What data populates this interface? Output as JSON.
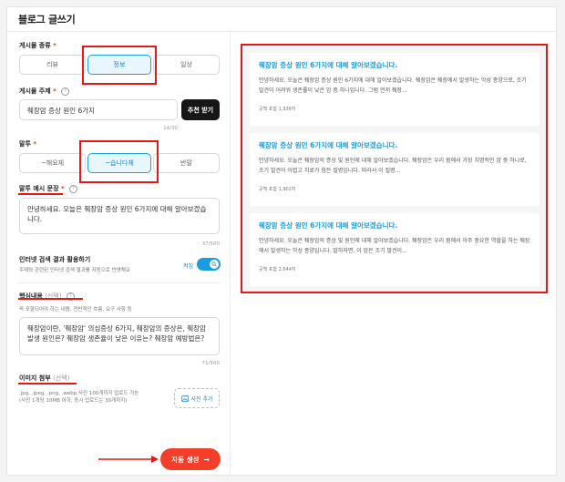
{
  "page": {
    "title": "블로그 글쓰기"
  },
  "post_type": {
    "label": "게시물 종류",
    "required_mark": "*",
    "options": [
      "리뷰",
      "정보",
      "일상"
    ],
    "selected": "정보"
  },
  "post_topic": {
    "label": "게시물 주제",
    "required_mark": "*",
    "value": "췌장암 증상 원인 6가지",
    "recommend_button": "추천 받기",
    "counter": "14/30"
  },
  "tone": {
    "label": "말투",
    "required_mark": "*",
    "options": [
      "~해요체",
      "~습니다체",
      "반말"
    ],
    "selected": "~습니다체"
  },
  "tone_example": {
    "label": "말투 예시 문장",
    "required_mark": "*",
    "value": "안녕하세요. 오늘은 췌장암 증상 원인 6가지에 대해 알아보겠습니다.",
    "counter": "37/500"
  },
  "internet_search": {
    "label": "인터넷 검색 결과 활용하기",
    "description": "주제와 관련된 인터넷 검색 결과를 자동으로 반영해요",
    "state_label": "켜짐",
    "enabled": true
  },
  "core_content": {
    "label": "핵심내용",
    "optional_mark": "(선택)",
    "hint": "꼭 포함되어야 하는 내용, 전반적인 흐름, 요구 사항 등",
    "value": "췌장암이란, '췌장암' 의심증상 6가지, 췌장암의 증상은, 췌장암 발생 원인은? 췌장암 생존율이 낮은 이유는? 췌장암 예방법은?",
    "counter": "71/500"
  },
  "image_attach": {
    "label": "이미지 첨부",
    "optional_mark": "(선택)",
    "hint_line1": ".jpg, .jpeg, .png, .webp 사진 100개까지 업로드 가능",
    "hint_line2": "(사진 1개당 10MB 이하, 동시 업로드는 30개까지)",
    "upload_button": "사진 추가"
  },
  "submit": {
    "label": "자동 생성",
    "arrow": "→"
  },
  "results": [
    {
      "title": "췌장암 증상 원인 6가지에 대해 알아보겠습니다.",
      "body": "안녕하세요. 오늘은 췌장암 증상 원인 6가지에 대해 알아보겠습니다. 췌장암은 췌장에서 발생하는 악성 종양으로, 조기 발견이 어려워 생존률이 낮은 암 중 하나입니다. 그럼 먼저 췌장...",
      "meta": "공백 포함 1,936자"
    },
    {
      "title": "췌장암 증상 원인 6가지에 대해 알아보겠습니다.",
      "body": "안녕하세요. 오늘은 췌장암의 증상 및 원인에 대해 알아보겠습니다. 췌장암은 우리 몸에서 가장 치명적인 암 중 하나로, 조기 발견이 어렵고 치료가 힘든 질병입니다. 따라서 이 질병...",
      "meta": "공백 포함 1,902자"
    },
    {
      "title": "췌장암 증상 원인 6가지에 대해 알아보겠습니다.",
      "body": "안녕하세요. 오늘은 췌장암의 증상 및 원인에 대해 알아보겠습니다. 췌장암은 우리 몸에서 아주 중요한 역할을 하는 췌장에서 발생하는 악성 종양입니다. 말하자면, 이 암은 조기 발견이...",
      "meta": "공백 포함 2,644자"
    }
  ],
  "colors": {
    "accent": "#1b9be0",
    "annotation": "#e21919",
    "submit": "#f33f2a"
  }
}
